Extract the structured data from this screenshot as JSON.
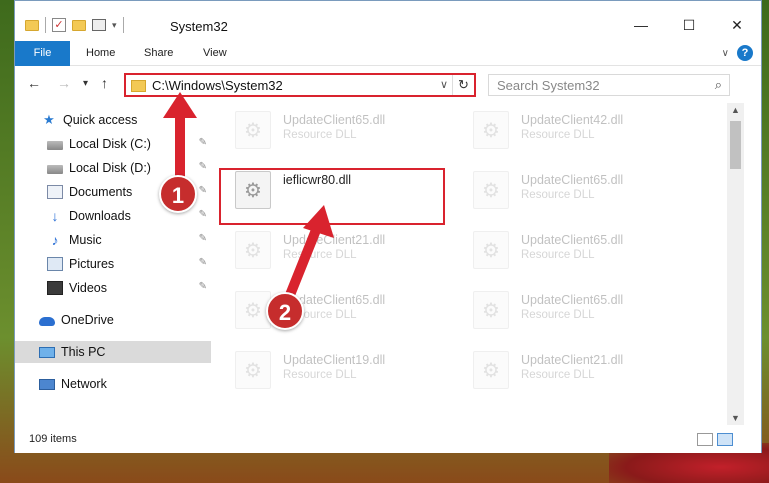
{
  "window": {
    "title": "System32",
    "controls": {
      "minimize": "—",
      "maximize": "☐",
      "close": "✕"
    }
  },
  "ribbon": {
    "tabs": [
      "File",
      "Home",
      "Share",
      "View"
    ],
    "help": "?"
  },
  "nav": {
    "back": "←",
    "forward": "→",
    "recent": "▾",
    "up": "↑",
    "address": "C:\\Windows\\System32",
    "refresh": "↻",
    "search_placeholder": "Search System32",
    "search_icon": "⌕"
  },
  "sidebar": {
    "items": [
      {
        "label": "Quick access",
        "icon": "star-icon"
      },
      {
        "label": "Local Disk (C:)",
        "icon": "drive-icon",
        "pinned": true
      },
      {
        "label": "Local Disk (D:)",
        "icon": "drive-icon",
        "pinned": true
      },
      {
        "label": "Documents",
        "icon": "documents-icon",
        "pinned": true
      },
      {
        "label": "Downloads",
        "icon": "download-icon",
        "pinned": true
      },
      {
        "label": "Music",
        "icon": "music-icon",
        "pinned": true
      },
      {
        "label": "Pictures",
        "icon": "pictures-icon",
        "pinned": true
      },
      {
        "label": "Videos",
        "icon": "videos-icon",
        "pinned": true
      },
      {
        "label": "OneDrive",
        "icon": "cloud-icon"
      },
      {
        "label": "This PC",
        "icon": "computer-icon",
        "selected": true
      },
      {
        "label": "Network",
        "icon": "network-icon"
      }
    ],
    "pin_glyph": "📌"
  },
  "files": {
    "col1": [
      {
        "name": "UpdateClient65.dll",
        "type": "Resource DLL"
      },
      {
        "name": "ieflicwr80.dll",
        "type": ""
      },
      {
        "name": "UpdateClient21.dll",
        "type": "Resource DLL"
      },
      {
        "name": "UpdateClient65.dll",
        "type": "Resource DLL"
      },
      {
        "name": "UpdateClient19.dll",
        "type": "Resource DLL"
      }
    ],
    "col2": [
      {
        "name": "UpdateClient42.dll",
        "type": "Resource DLL"
      },
      {
        "name": "UpdateClient65.dll",
        "type": "Resource DLL"
      },
      {
        "name": "UpdateClient65.dll",
        "type": "Resource DLL"
      },
      {
        "name": "UpdateClient65.dll",
        "type": "Resource DLL"
      },
      {
        "name": "UpdateClient21.dll",
        "type": "Resource DLL"
      }
    ]
  },
  "status": {
    "item_count": "109 items"
  },
  "annotations": {
    "step1": "1",
    "step2": "2",
    "accent_color": "#d9232e"
  }
}
